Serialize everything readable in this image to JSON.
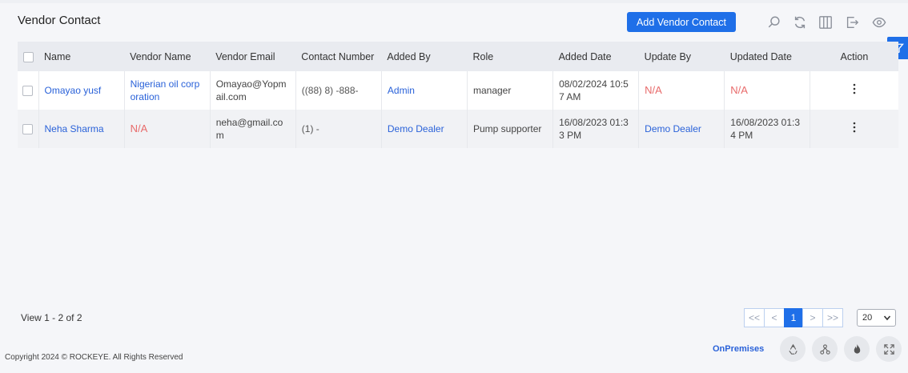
{
  "page": {
    "title": "Vendor Contact",
    "add_button_label": "Add Vendor Contact"
  },
  "toolbar": {
    "icons": [
      "search-icon",
      "refresh-icon",
      "columns-icon",
      "export-icon",
      "eye-icon",
      "filter-icon"
    ]
  },
  "table": {
    "headers": {
      "name": "Name",
      "vendor_name": "Vendor Name",
      "vendor_email": "Vendor Email",
      "contact_number": "Contact Number",
      "added_by": "Added By",
      "role": "Role",
      "added_date": "Added Date",
      "update_by": "Update By",
      "updated_date": "Updated Date",
      "action": "Action"
    },
    "rows": [
      {
        "name": "Omayao yusf",
        "vendor_name": "Nigerian oil corporation",
        "vendor_email": "Omayao@Yopmail.com",
        "contact_number": "((88) 8) -888-",
        "added_by": "Admin",
        "role": "manager",
        "added_date": "08/02/2024 10:57 AM",
        "update_by": "N/A",
        "updated_date": "N/A"
      },
      {
        "name": "Neha Sharma",
        "vendor_name": "N/A",
        "vendor_email": "neha@gmail.com",
        "contact_number": "(1) -",
        "added_by": "Demo Dealer",
        "role": "Pump supporter",
        "added_date": "16/08/2023 01:33 PM",
        "update_by": "Demo Dealer",
        "updated_date": "16/08/2023 01:34 PM"
      }
    ]
  },
  "pagination": {
    "view_text": "View 1 - 2 of 2",
    "first": "<<",
    "prev": "<",
    "current": "1",
    "next": ">",
    "last": ">>",
    "per_page": "20"
  },
  "footer": {
    "copyright": "Copyright 2024 © ROCKEYE. All Rights Reserved",
    "mode_label": "OnPremises",
    "icons": [
      "recycle-icon",
      "network-icon",
      "fire-icon",
      "expand-icon"
    ]
  },
  "colors": {
    "accent": "#1f6fe8",
    "link": "#2a62d9",
    "na": "#e86b6b",
    "header_bg": "#e9ebf0"
  }
}
